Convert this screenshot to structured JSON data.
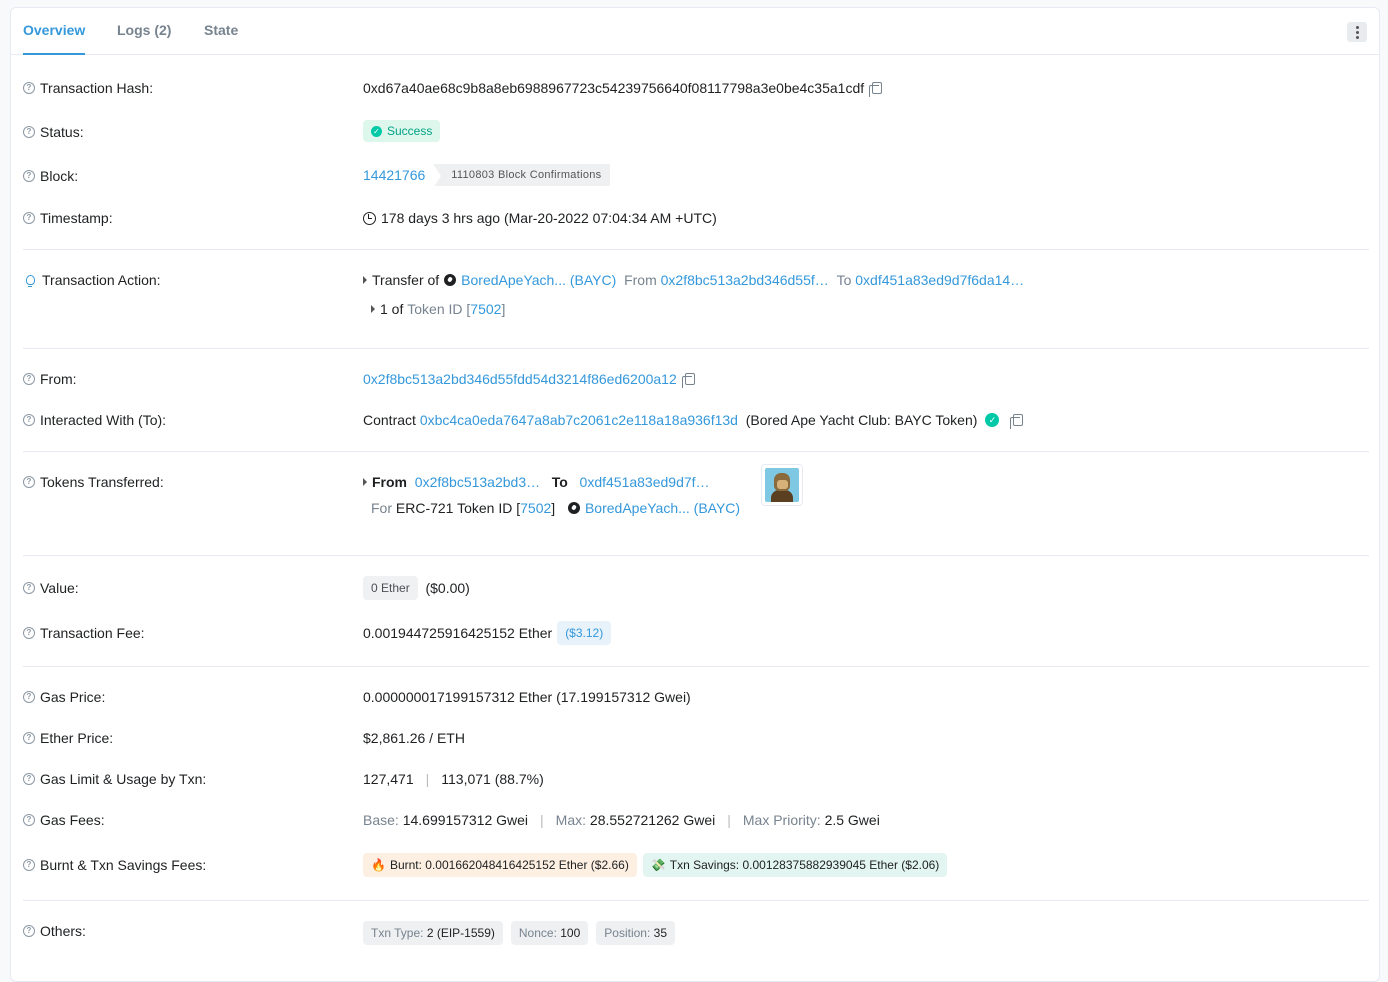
{
  "tabs": [
    {
      "label": "Overview"
    },
    {
      "label": "Logs (2)"
    },
    {
      "label": "State"
    }
  ],
  "labels": {
    "tx_hash": "Transaction Hash:",
    "status": "Status:",
    "block": "Block:",
    "timestamp": "Timestamp:",
    "tx_action": "Transaction Action:",
    "from": "From:",
    "interacted": "Interacted With (To):",
    "tokens": "Tokens Transferred:",
    "value": "Value:",
    "tx_fee": "Transaction Fee:",
    "gas_price": "Gas Price:",
    "ether_price": "Ether Price:",
    "gas_limit": "Gas Limit & Usage by Txn:",
    "gas_fees": "Gas Fees:",
    "burnt": "Burnt & Txn Savings Fees:",
    "others": "Others:"
  },
  "tx_hash": "0xd67a40ae68c9b8a8eb6988967723c54239756640f08117798a3e0be4c35a1cdf",
  "status": "Success",
  "block": {
    "number": "14421766",
    "confirmations": "1110803 Block Confirmations"
  },
  "timestamp": "178 days 3 hrs ago (Mar-20-2022 07:04:34 AM +UTC)",
  "action": {
    "transfer_of": "Transfer of",
    "token": "BoredApeYach... (BAYC)",
    "from_label": "From",
    "from_addr": "0x2f8bc513a2bd346d55f…",
    "to_label": "To",
    "to_addr": "0xdf451a83ed9d7f6da14…",
    "amount": "1 of",
    "token_id_label": "Token ID [",
    "token_id": "7502",
    "bracket_close": "]"
  },
  "from_addr": "0x2f8bc513a2bd346d55fdd54d3214f86ed6200a12",
  "interacted": {
    "prefix": "Contract",
    "addr": "0xbc4ca0eda7647a8ab7c2061c2e118a18a936f13d",
    "name": "(Bored Ape Yacht Club: BAYC Token)"
  },
  "tokens_transferred": {
    "from_label": "From",
    "from_addr": "0x2f8bc513a2bd3…",
    "to_label": "To",
    "to_addr": "0xdf451a83ed9d7f…",
    "for_label": "For",
    "standard": "ERC-721 Token ID [",
    "token_id": "7502",
    "bracket_close": "]",
    "token": "BoredApeYach... (BAYC)"
  },
  "value": {
    "amount": "0 Ether",
    "usd": "($0.00)"
  },
  "tx_fee": {
    "amount": "0.001944725916425152 Ether",
    "usd": "($3.12)"
  },
  "gas_price": "0.000000017199157312 Ether (17.199157312 Gwei)",
  "ether_price": "$2,861.26 / ETH",
  "gas_limit": {
    "limit": "127,471",
    "sep": "|",
    "usage": "113,071 (88.7%)"
  },
  "gas_fees": {
    "base_label": "Base:",
    "base": "14.699157312 Gwei",
    "max_label": "Max:",
    "max": "28.552721262 Gwei",
    "priority_label": "Max Priority:",
    "priority": "2.5 Gwei",
    "sep": "|"
  },
  "burnt_fees": {
    "burnt_icon": "🔥",
    "burnt": "Burnt: 0.001662048416425152 Ether ($2.66)",
    "savings_icon": "💸",
    "savings": "Txn Savings: 0.00128375882939045 Ether ($2.06)"
  },
  "others": [
    {
      "key": "Txn Type:",
      "value": "2 (EIP-1559)"
    },
    {
      "key": "Nonce:",
      "value": "100"
    },
    {
      "key": "Position:",
      "value": "35"
    }
  ],
  "colors": {
    "accent": "#3498db",
    "success": "#00c9a7"
  },
  "icons": {
    "help": "question-circle-icon",
    "copy": "copy-icon",
    "clock": "clock-icon",
    "bulb": "lightbulb-icon",
    "verified": "verified-check-icon",
    "kebab": "more-vertical-icon"
  }
}
